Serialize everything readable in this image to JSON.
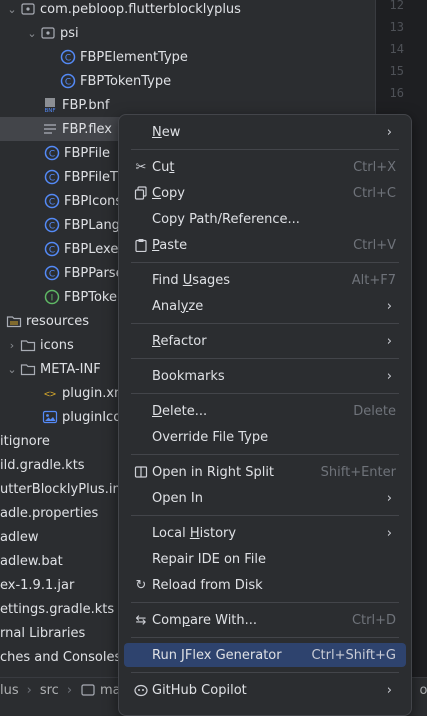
{
  "tree": {
    "items": [
      {
        "label": "com.pebloop.flutterblocklyplus",
        "icon": "package-icon"
      },
      {
        "label": "psi",
        "icon": "package-icon"
      },
      {
        "label": "FBPElementType",
        "icon": "class-icon"
      },
      {
        "label": "FBPTokenType",
        "icon": "class-icon"
      },
      {
        "label": "FBP.bnf",
        "icon": "bnf-file-icon"
      },
      {
        "label": "FBP.flex",
        "icon": "text-file-icon"
      },
      {
        "label": "FBPFile",
        "icon": "class-icon"
      },
      {
        "label": "FBPFileT",
        "icon": "class-icon"
      },
      {
        "label": "FBPIcons",
        "icon": "class-icon"
      },
      {
        "label": "FBPLang",
        "icon": "class-icon"
      },
      {
        "label": "FBPLexe",
        "icon": "class-icon"
      },
      {
        "label": "FBPParse",
        "icon": "class-icon"
      },
      {
        "label": "FBPToke",
        "icon": "interface-icon"
      },
      {
        "label": "resources",
        "icon": "resources-folder-icon"
      },
      {
        "label": "icons",
        "icon": "folder-icon"
      },
      {
        "label": "META-INF",
        "icon": "folder-icon"
      },
      {
        "label": "plugin.xm",
        "icon": "xml-file-icon"
      },
      {
        "label": "pluginIco",
        "icon": "image-file-icon"
      },
      {
        "label": "itignore",
        "icon": "none"
      },
      {
        "label": "ild.gradle.kts",
        "icon": "none"
      },
      {
        "label": "utterBlocklyPlus.iml",
        "icon": "none"
      },
      {
        "label": "adle.properties",
        "icon": "none"
      },
      {
        "label": "adlew",
        "icon": "none"
      },
      {
        "label": "adlew.bat",
        "icon": "none"
      },
      {
        "label": "ex-1.9.1.jar",
        "icon": "none"
      },
      {
        "label": "ettings.gradle.kts",
        "icon": "none"
      },
      {
        "label": "rnal Libraries",
        "icon": "none"
      },
      {
        "label": "ches and Consoles",
        "icon": "none"
      }
    ]
  },
  "gutter": {
    "lines": [
      "12",
      "13",
      "14",
      "15",
      "16"
    ]
  },
  "status": {
    "p1": "lus",
    "p2": "src",
    "p3": "main",
    "p4": "olu"
  },
  "menu": {
    "items": [
      {
        "label": "New",
        "shortcut": "",
        "submenu": true,
        "icon": ""
      },
      {
        "label": "Cut",
        "shortcut": "Ctrl+X",
        "submenu": false,
        "icon": "scissors-icon"
      },
      {
        "label": "Copy",
        "shortcut": "Ctrl+C",
        "submenu": false,
        "icon": "copy-icon"
      },
      {
        "label": "Copy Path/Reference...",
        "shortcut": "",
        "submenu": false,
        "icon": ""
      },
      {
        "label": "Paste",
        "shortcut": "Ctrl+V",
        "submenu": false,
        "icon": "clipboard-icon"
      },
      {
        "label": "Find Usages",
        "shortcut": "Alt+F7",
        "submenu": false,
        "icon": ""
      },
      {
        "label": "Analyze",
        "shortcut": "",
        "submenu": true,
        "icon": ""
      },
      {
        "label": "Refactor",
        "shortcut": "",
        "submenu": true,
        "icon": ""
      },
      {
        "label": "Bookmarks",
        "shortcut": "",
        "submenu": true,
        "icon": ""
      },
      {
        "label": "Delete...",
        "shortcut": "Delete",
        "submenu": false,
        "icon": ""
      },
      {
        "label": "Override File Type",
        "shortcut": "",
        "submenu": false,
        "icon": ""
      },
      {
        "label": "Open in Right Split",
        "shortcut": "Shift+Enter",
        "submenu": false,
        "icon": "split-icon"
      },
      {
        "label": "Open In",
        "shortcut": "",
        "submenu": true,
        "icon": ""
      },
      {
        "label": "Local History",
        "shortcut": "",
        "submenu": true,
        "icon": ""
      },
      {
        "label": "Repair IDE on File",
        "shortcut": "",
        "submenu": false,
        "icon": ""
      },
      {
        "label": "Reload from Disk",
        "shortcut": "",
        "submenu": false,
        "icon": "reload-icon"
      },
      {
        "label": "Compare With...",
        "shortcut": "Ctrl+D",
        "submenu": false,
        "icon": "compare-icon"
      },
      {
        "label": "Run JFlex Generator",
        "shortcut": "Ctrl+Shift+G",
        "submenu": false,
        "icon": ""
      },
      {
        "label": "GitHub Copilot",
        "shortcut": "",
        "submenu": true,
        "icon": "copilot-icon"
      }
    ]
  },
  "colors": {
    "selection": "#43454a",
    "menu_highlight": "#2e436e",
    "class_icon": "#548af7",
    "interface_icon": "#5fb865"
  }
}
